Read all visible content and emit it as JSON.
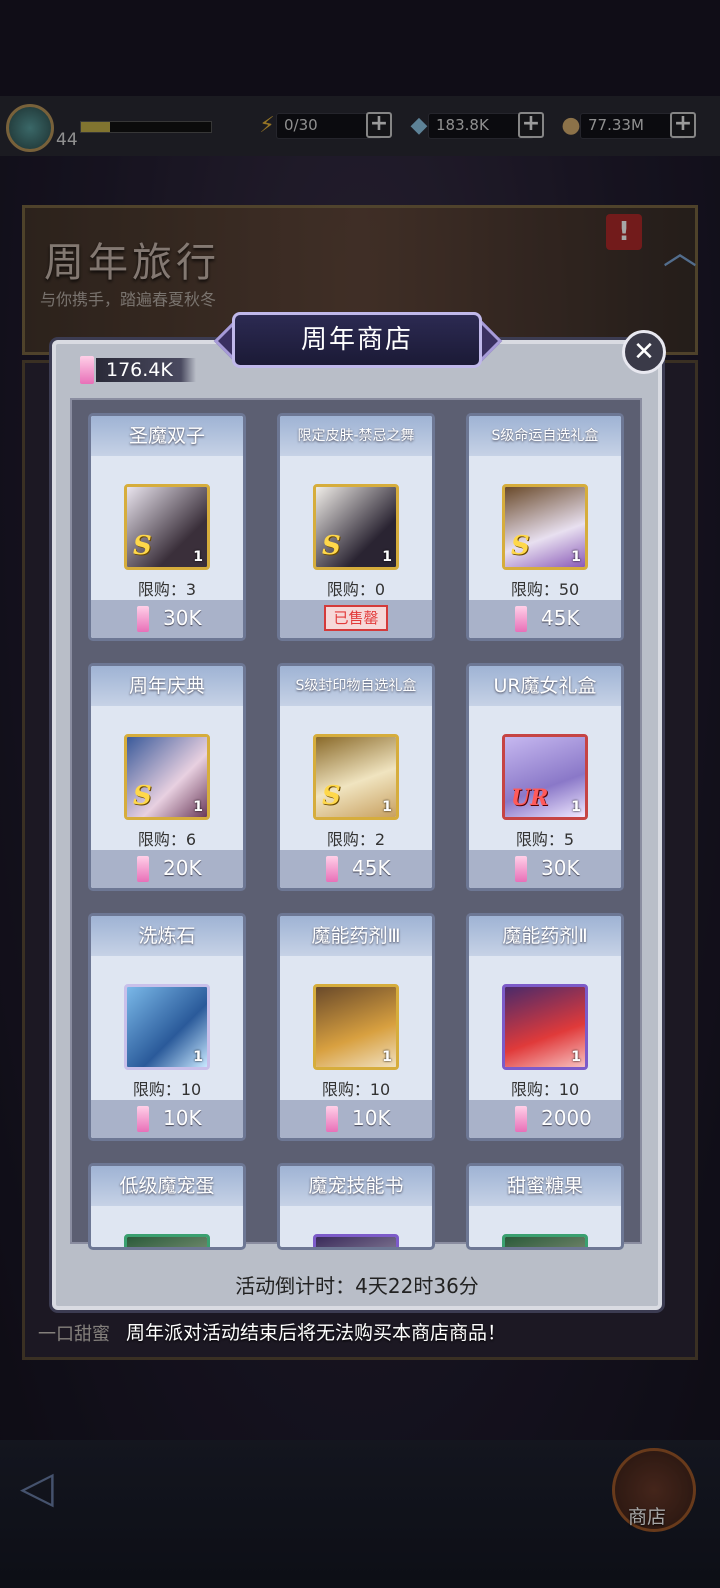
{
  "status_bar": {
    "level": "44",
    "xp_progress": 0.22,
    "energy": "0/30",
    "gems": "183.8K",
    "coins": "77.33M",
    "plus_label": "+"
  },
  "background": {
    "banner_title": "周年旅行",
    "banner_subtitle": "与你携手，踏遍春夏秋冬",
    "bottom_text": "一口甜蜜",
    "alert_label": "!"
  },
  "shop": {
    "title": "周年商店",
    "close_label": "✕",
    "currency_value": "176.4K",
    "countdown": "活动倒计时：4天22时36分",
    "notice": "周年派对活动结束后将无法购买本商店商品！",
    "soldout_label": "已售罄",
    "items": [
      {
        "name": "圣魔双子",
        "rank": "S",
        "qty": "1",
        "limit": "限购：3",
        "price": "30K"
      },
      {
        "name": "限定皮肤-禁忌之舞",
        "rank": "S",
        "qty": "1",
        "limit": "限购：0",
        "price": ""
      },
      {
        "name": "S级命运自选礼盒",
        "rank": "S",
        "qty": "1",
        "limit": "限购：50",
        "price": "45K"
      },
      {
        "name": "周年庆典",
        "rank": "S",
        "qty": "1",
        "limit": "限购：6",
        "price": "20K"
      },
      {
        "name": "S级封印物自选礼盒",
        "rank": "S",
        "qty": "1",
        "limit": "限购：2",
        "price": "45K"
      },
      {
        "name": "UR魔女礼盒",
        "rank": "UR",
        "qty": "1",
        "limit": "限购：5",
        "price": "30K"
      },
      {
        "name": "洗炼石",
        "rank": "",
        "qty": "1",
        "limit": "限购：10",
        "price": "10K"
      },
      {
        "name": "魔能药剂Ⅲ",
        "rank": "",
        "qty": "1",
        "limit": "限购：10",
        "price": "10K"
      },
      {
        "name": "魔能药剂Ⅱ",
        "rank": "",
        "qty": "1",
        "limit": "限购：10",
        "price": "2000"
      },
      {
        "name": "低级魔宠蛋",
        "rank": "",
        "qty": "",
        "limit": "",
        "price": ""
      },
      {
        "name": "魔宠技能书",
        "rank": "",
        "qty": "",
        "limit": "",
        "price": ""
      },
      {
        "name": "甜蜜糖果",
        "rank": "",
        "qty": "",
        "limit": "",
        "price": ""
      }
    ]
  },
  "nav": {
    "shop_label": "商店"
  },
  "colors": {
    "accent_pink": "#e870b8",
    "soldout_red": "#d43a3a"
  }
}
